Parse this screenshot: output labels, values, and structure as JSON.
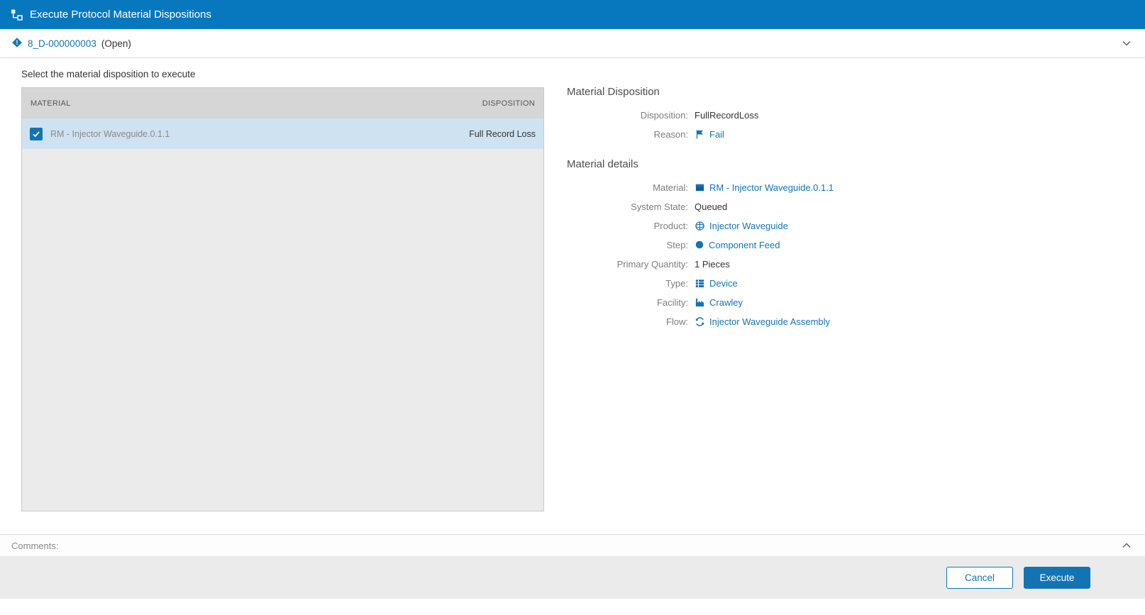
{
  "header": {
    "title": "Execute Protocol Material Dispositions"
  },
  "record_bar": {
    "link": "8_D-000000003",
    "status": "(Open)"
  },
  "selection": {
    "instruction": "Select the material disposition to execute",
    "table": {
      "columns": [
        "MATERIAL",
        "DISPOSITION"
      ],
      "rows": [
        {
          "material": "RM - Injector Waveguide.0.1.1",
          "disposition": "Full Record Loss",
          "checked": true
        }
      ]
    }
  },
  "panel": {
    "disposition": {
      "title": "Material Disposition",
      "fields": [
        {
          "label": "Disposition:",
          "value": "FullRecordLoss",
          "type": "text"
        },
        {
          "label": "Reason:",
          "value": "Fail",
          "type": "link",
          "icon": "flag-icon"
        }
      ]
    },
    "material": {
      "title": "Material details",
      "fields": [
        {
          "label": "Material:",
          "value": "RM - Injector Waveguide.0.1.1",
          "type": "link",
          "icon": "material-icon"
        },
        {
          "label": "System State:",
          "value": "Queued",
          "type": "text"
        },
        {
          "label": "Product:",
          "value": "Injector Waveguide",
          "type": "link",
          "icon": "product-icon"
        },
        {
          "label": "Step:",
          "value": "Component Feed",
          "type": "link",
          "icon": "step-icon"
        },
        {
          "label": "Primary Quantity:",
          "value": "1  Pieces",
          "type": "text"
        },
        {
          "label": "Type:",
          "value": "Device",
          "type": "link",
          "icon": "device-icon"
        },
        {
          "label": "Facility:",
          "value": "Crawley",
          "type": "link",
          "icon": "facility-icon"
        },
        {
          "label": "Flow:",
          "value": "Injector Waveguide Assembly",
          "type": "link",
          "icon": "flow-icon"
        }
      ]
    }
  },
  "comments": {
    "label": "Comments:"
  },
  "footer": {
    "cancel_label": "Cancel",
    "execute_label": "Execute"
  },
  "colors": {
    "accent": "#0878be",
    "link": "#1374b4",
    "selected_row": "#cfe2f2"
  }
}
